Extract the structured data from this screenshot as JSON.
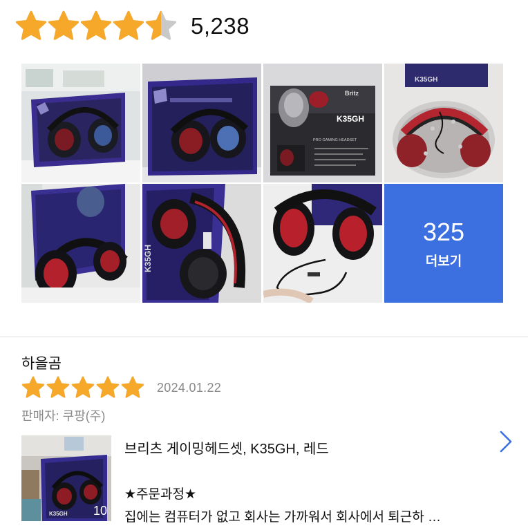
{
  "summary": {
    "rating": 4.5,
    "max_stars": 5,
    "star_color": "#f6a82a",
    "star_empty_color": "#c9c9c9",
    "count": "5,238"
  },
  "photos": [
    {
      "alt": "headset-box-photo"
    },
    {
      "alt": "headset-box-photo"
    },
    {
      "alt": "box-back-photo",
      "brand": "Britz",
      "model": "K35GH",
      "tagline": "PRO GAMING HEADSET"
    },
    {
      "alt": "headset-wrapped-photo"
    },
    {
      "alt": "headset-on-box-photo"
    },
    {
      "alt": "headset-closeup-photo",
      "model": "K35GH"
    },
    {
      "alt": "headset-cable-photo"
    }
  ],
  "more": {
    "count": "325",
    "label": "더보기",
    "color": "#3c6fe0"
  },
  "review": {
    "reviewer": "하을곰",
    "rating": 5,
    "date": "2024.01.22",
    "seller": "판매자: 쿠팡(주)",
    "product_name": "브리츠 게이밍헤드셋, K35GH, 레드",
    "thumb_count": "10",
    "order_title": "★주문과정★",
    "text": "집에는 컴퓨터가 없고 회사는 가까워서 회사에서 퇴근하 …"
  },
  "accent_color": "#3c6fe0"
}
